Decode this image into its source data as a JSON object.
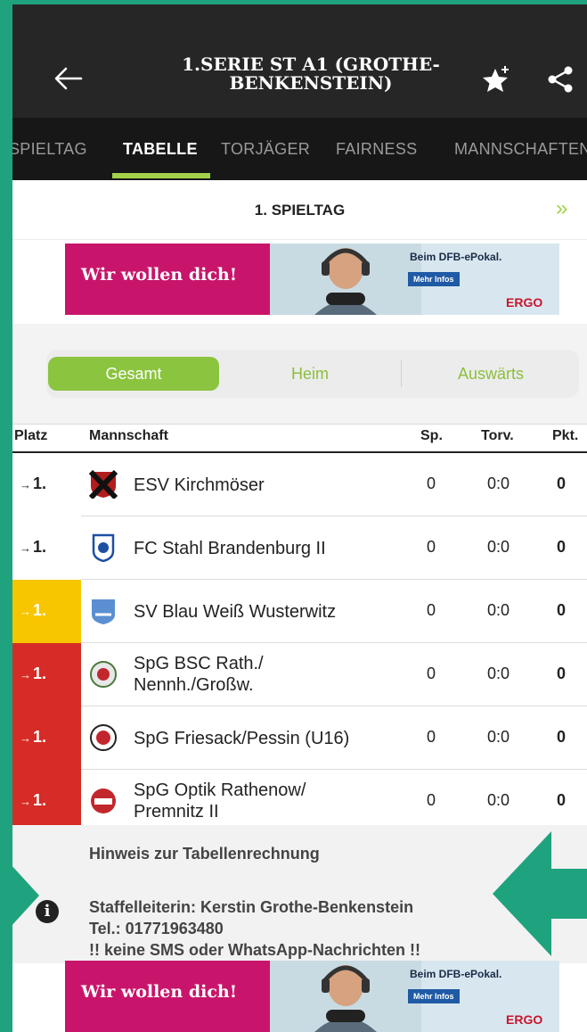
{
  "header": {
    "title": "1.SERIE ST A1 (GROTHE-BENKENSTEIN)",
    "back_icon": "arrow-left-icon",
    "favorite_icon": "star-plus-icon",
    "share_icon": "share-icon"
  },
  "tabs": [
    {
      "label": "SPIELTAG",
      "active": false
    },
    {
      "label": "TABELLE",
      "active": true
    },
    {
      "label": "TORJÄGER",
      "active": false
    },
    {
      "label": "FAIRNESS",
      "active": false
    },
    {
      "label": "MANNSCHAFTEN",
      "active": false
    }
  ],
  "matchday": {
    "label": "1. SPIELTAG",
    "next_icon": "double-chevron-right-icon"
  },
  "ad": {
    "headline": "Wir wollen dich!",
    "title": "Beim DFB-ePokal.",
    "button": "Mehr Infos",
    "brand": "ERGO"
  },
  "filter": {
    "options": [
      "Gesamt",
      "Heim",
      "Auswärts"
    ],
    "selected": "Gesamt"
  },
  "table": {
    "headers": {
      "place": "Platz",
      "team": "Mannschaft",
      "played": "Sp.",
      "goals": "Torv.",
      "points": "Pkt."
    },
    "rows": [
      {
        "place": "1.",
        "team": "ESV Kirchmöser",
        "played": "0",
        "goals": "0:0",
        "points": "0",
        "highlight": "none"
      },
      {
        "place": "1.",
        "team": "FC Stahl Brandenburg II",
        "played": "0",
        "goals": "0:0",
        "points": "0",
        "highlight": "none"
      },
      {
        "place": "1.",
        "team": "SV Blau Weiß Wusterwitz",
        "played": "0",
        "goals": "0:0",
        "points": "0",
        "highlight": "yellow"
      },
      {
        "place": "1.",
        "team_line1": "SpG BSC Rath./",
        "team_line2": "Nennh./Großw.",
        "played": "0",
        "goals": "0:0",
        "points": "0",
        "highlight": "red"
      },
      {
        "place": "1.",
        "team": "SpG Friesack/Pessin (U16)",
        "played": "0",
        "goals": "0:0",
        "points": "0",
        "highlight": "red"
      },
      {
        "place": "1.",
        "team_line1": "SpG Optik Rathenow/",
        "team_line2": "Premnitz II",
        "played": "0",
        "goals": "0:0",
        "points": "0",
        "highlight": "red"
      }
    ],
    "colors": {
      "yellow": "#f7c600",
      "red": "#d62b26"
    }
  },
  "info": {
    "title": "Hinweis zur Tabellenrechnung",
    "icon": "info-icon",
    "line1": "Staffelleiterin: Kerstin Grothe-Benkenstein",
    "line2": "Tel.: 01771963480",
    "line3": "!! keine SMS oder WhatsApp-Nachrichten !!"
  },
  "colors": {
    "accent": "#8bc43f",
    "header": "#262626",
    "tabs": "#171717",
    "overlay": "#1fa37e"
  }
}
